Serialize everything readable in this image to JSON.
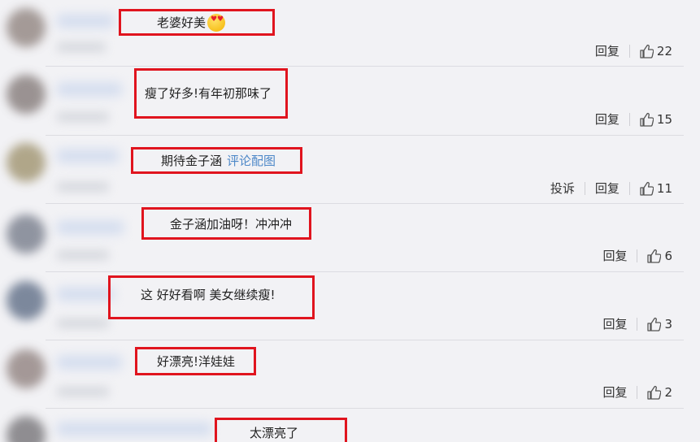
{
  "comments": [
    {
      "text": "老婆好美",
      "emoji": "smiling-face-with-heart-eyes-icon",
      "link": "",
      "actions": [
        "回复"
      ],
      "likes": "22"
    },
    {
      "text": "瘦了好多!有年初那味了",
      "emoji": "",
      "link": "",
      "actions": [
        "回复"
      ],
      "likes": "15"
    },
    {
      "text": "期待金子涵",
      "emoji": "",
      "link": "评论配图",
      "actions": [
        "投诉",
        "回复"
      ],
      "likes": "11"
    },
    {
      "text": "金子涵加油呀！冲冲冲",
      "emoji": "",
      "link": "",
      "actions": [
        "回复"
      ],
      "likes": "6"
    },
    {
      "text": "这 好好看啊 美女继续瘦!",
      "emoji": "",
      "link": "",
      "actions": [
        "回复"
      ],
      "likes": "3"
    },
    {
      "text": "好漂亮!洋娃娃",
      "emoji": "",
      "link": "",
      "actions": [
        "回复"
      ],
      "likes": "2"
    },
    {
      "text": "太漂亮了",
      "emoji": "",
      "link": "",
      "actions": [],
      "likes": ""
    }
  ],
  "colors": {
    "highlight_box": "#e0141e",
    "link": "#4d88c8",
    "background": "#f2f2f5"
  }
}
